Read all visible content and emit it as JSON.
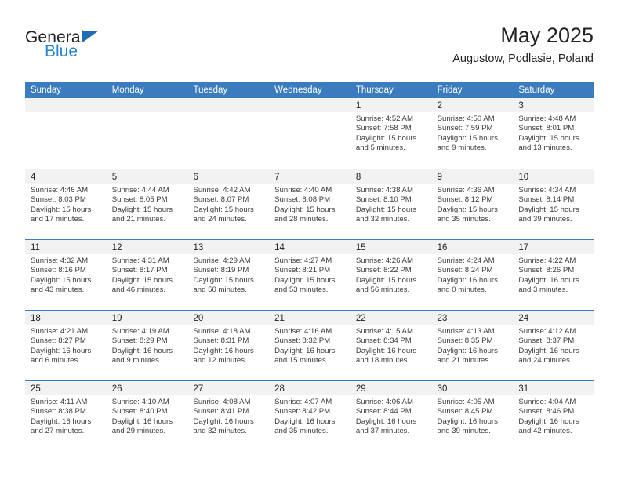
{
  "brand": {
    "name_top": "General",
    "name_bottom": "Blue",
    "accent_color": "#2585d3",
    "triangle_color": "#1f6eb5"
  },
  "header": {
    "title": "May 2025",
    "subtitle": "Augustow, Podlasie, Poland"
  },
  "theme": {
    "header_row_bg": "#3a7cbe",
    "daynum_band_bg": "#f2f2f2",
    "text_color": "#231f20"
  },
  "weekdays": [
    "Sunday",
    "Monday",
    "Tuesday",
    "Wednesday",
    "Thursday",
    "Friday",
    "Saturday"
  ],
  "weeks": [
    [
      {
        "day": "",
        "empty": true
      },
      {
        "day": "",
        "empty": true
      },
      {
        "day": "",
        "empty": true
      },
      {
        "day": "",
        "empty": true
      },
      {
        "day": "1",
        "sunrise": "Sunrise: 4:52 AM",
        "sunset": "Sunset: 7:58 PM",
        "daylight1": "Daylight: 15 hours",
        "daylight2": "and 5 minutes."
      },
      {
        "day": "2",
        "sunrise": "Sunrise: 4:50 AM",
        "sunset": "Sunset: 7:59 PM",
        "daylight1": "Daylight: 15 hours",
        "daylight2": "and 9 minutes."
      },
      {
        "day": "3",
        "sunrise": "Sunrise: 4:48 AM",
        "sunset": "Sunset: 8:01 PM",
        "daylight1": "Daylight: 15 hours",
        "daylight2": "and 13 minutes."
      }
    ],
    [
      {
        "day": "4",
        "sunrise": "Sunrise: 4:46 AM",
        "sunset": "Sunset: 8:03 PM",
        "daylight1": "Daylight: 15 hours",
        "daylight2": "and 17 minutes."
      },
      {
        "day": "5",
        "sunrise": "Sunrise: 4:44 AM",
        "sunset": "Sunset: 8:05 PM",
        "daylight1": "Daylight: 15 hours",
        "daylight2": "and 21 minutes."
      },
      {
        "day": "6",
        "sunrise": "Sunrise: 4:42 AM",
        "sunset": "Sunset: 8:07 PM",
        "daylight1": "Daylight: 15 hours",
        "daylight2": "and 24 minutes."
      },
      {
        "day": "7",
        "sunrise": "Sunrise: 4:40 AM",
        "sunset": "Sunset: 8:08 PM",
        "daylight1": "Daylight: 15 hours",
        "daylight2": "and 28 minutes."
      },
      {
        "day": "8",
        "sunrise": "Sunrise: 4:38 AM",
        "sunset": "Sunset: 8:10 PM",
        "daylight1": "Daylight: 15 hours",
        "daylight2": "and 32 minutes."
      },
      {
        "day": "9",
        "sunrise": "Sunrise: 4:36 AM",
        "sunset": "Sunset: 8:12 PM",
        "daylight1": "Daylight: 15 hours",
        "daylight2": "and 35 minutes."
      },
      {
        "day": "10",
        "sunrise": "Sunrise: 4:34 AM",
        "sunset": "Sunset: 8:14 PM",
        "daylight1": "Daylight: 15 hours",
        "daylight2": "and 39 minutes."
      }
    ],
    [
      {
        "day": "11",
        "sunrise": "Sunrise: 4:32 AM",
        "sunset": "Sunset: 8:16 PM",
        "daylight1": "Daylight: 15 hours",
        "daylight2": "and 43 minutes."
      },
      {
        "day": "12",
        "sunrise": "Sunrise: 4:31 AM",
        "sunset": "Sunset: 8:17 PM",
        "daylight1": "Daylight: 15 hours",
        "daylight2": "and 46 minutes."
      },
      {
        "day": "13",
        "sunrise": "Sunrise: 4:29 AM",
        "sunset": "Sunset: 8:19 PM",
        "daylight1": "Daylight: 15 hours",
        "daylight2": "and 50 minutes."
      },
      {
        "day": "14",
        "sunrise": "Sunrise: 4:27 AM",
        "sunset": "Sunset: 8:21 PM",
        "daylight1": "Daylight: 15 hours",
        "daylight2": "and 53 minutes."
      },
      {
        "day": "15",
        "sunrise": "Sunrise: 4:26 AM",
        "sunset": "Sunset: 8:22 PM",
        "daylight1": "Daylight: 15 hours",
        "daylight2": "and 56 minutes."
      },
      {
        "day": "16",
        "sunrise": "Sunrise: 4:24 AM",
        "sunset": "Sunset: 8:24 PM",
        "daylight1": "Daylight: 16 hours",
        "daylight2": "and 0 minutes."
      },
      {
        "day": "17",
        "sunrise": "Sunrise: 4:22 AM",
        "sunset": "Sunset: 8:26 PM",
        "daylight1": "Daylight: 16 hours",
        "daylight2": "and 3 minutes."
      }
    ],
    [
      {
        "day": "18",
        "sunrise": "Sunrise: 4:21 AM",
        "sunset": "Sunset: 8:27 PM",
        "daylight1": "Daylight: 16 hours",
        "daylight2": "and 6 minutes."
      },
      {
        "day": "19",
        "sunrise": "Sunrise: 4:19 AM",
        "sunset": "Sunset: 8:29 PM",
        "daylight1": "Daylight: 16 hours",
        "daylight2": "and 9 minutes."
      },
      {
        "day": "20",
        "sunrise": "Sunrise: 4:18 AM",
        "sunset": "Sunset: 8:31 PM",
        "daylight1": "Daylight: 16 hours",
        "daylight2": "and 12 minutes."
      },
      {
        "day": "21",
        "sunrise": "Sunrise: 4:16 AM",
        "sunset": "Sunset: 8:32 PM",
        "daylight1": "Daylight: 16 hours",
        "daylight2": "and 15 minutes."
      },
      {
        "day": "22",
        "sunrise": "Sunrise: 4:15 AM",
        "sunset": "Sunset: 8:34 PM",
        "daylight1": "Daylight: 16 hours",
        "daylight2": "and 18 minutes."
      },
      {
        "day": "23",
        "sunrise": "Sunrise: 4:13 AM",
        "sunset": "Sunset: 8:35 PM",
        "daylight1": "Daylight: 16 hours",
        "daylight2": "and 21 minutes."
      },
      {
        "day": "24",
        "sunrise": "Sunrise: 4:12 AM",
        "sunset": "Sunset: 8:37 PM",
        "daylight1": "Daylight: 16 hours",
        "daylight2": "and 24 minutes."
      }
    ],
    [
      {
        "day": "25",
        "sunrise": "Sunrise: 4:11 AM",
        "sunset": "Sunset: 8:38 PM",
        "daylight1": "Daylight: 16 hours",
        "daylight2": "and 27 minutes."
      },
      {
        "day": "26",
        "sunrise": "Sunrise: 4:10 AM",
        "sunset": "Sunset: 8:40 PM",
        "daylight1": "Daylight: 16 hours",
        "daylight2": "and 29 minutes."
      },
      {
        "day": "27",
        "sunrise": "Sunrise: 4:08 AM",
        "sunset": "Sunset: 8:41 PM",
        "daylight1": "Daylight: 16 hours",
        "daylight2": "and 32 minutes."
      },
      {
        "day": "28",
        "sunrise": "Sunrise: 4:07 AM",
        "sunset": "Sunset: 8:42 PM",
        "daylight1": "Daylight: 16 hours",
        "daylight2": "and 35 minutes."
      },
      {
        "day": "29",
        "sunrise": "Sunrise: 4:06 AM",
        "sunset": "Sunset: 8:44 PM",
        "daylight1": "Daylight: 16 hours",
        "daylight2": "and 37 minutes."
      },
      {
        "day": "30",
        "sunrise": "Sunrise: 4:05 AM",
        "sunset": "Sunset: 8:45 PM",
        "daylight1": "Daylight: 16 hours",
        "daylight2": "and 39 minutes."
      },
      {
        "day": "31",
        "sunrise": "Sunrise: 4:04 AM",
        "sunset": "Sunset: 8:46 PM",
        "daylight1": "Daylight: 16 hours",
        "daylight2": "and 42 minutes."
      }
    ]
  ]
}
